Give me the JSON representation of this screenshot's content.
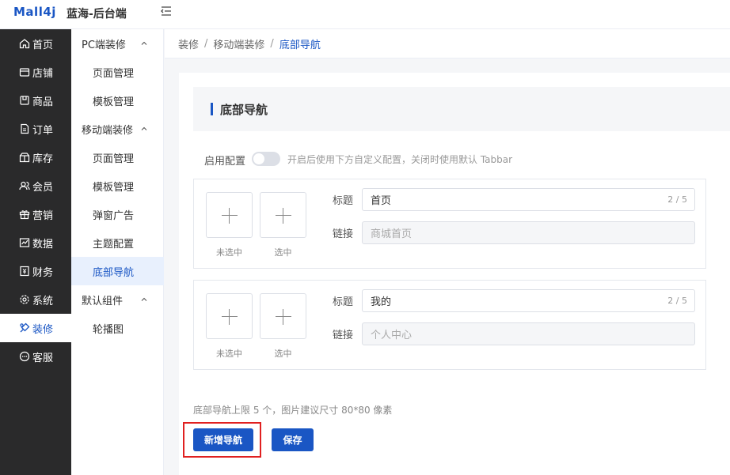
{
  "app": {
    "logo": "Mall4j",
    "name": "蓝海-后台端"
  },
  "sidebar": {
    "items": [
      {
        "label": "首页",
        "icon": "home-icon"
      },
      {
        "label": "店铺",
        "icon": "store-icon"
      },
      {
        "label": "商品",
        "icon": "goods-icon"
      },
      {
        "label": "订单",
        "icon": "order-icon"
      },
      {
        "label": "库存",
        "icon": "inventory-icon"
      },
      {
        "label": "会员",
        "icon": "member-icon"
      },
      {
        "label": "营销",
        "icon": "gift-icon"
      },
      {
        "label": "数据",
        "icon": "chart-icon"
      },
      {
        "label": "财务",
        "icon": "finance-icon"
      },
      {
        "label": "系统",
        "icon": "gear-icon"
      },
      {
        "label": "装修",
        "icon": "decorate-icon",
        "active": true
      },
      {
        "label": "客服",
        "icon": "chat-icon"
      }
    ]
  },
  "submenu": {
    "groups": [
      {
        "label": "PC端装修",
        "items": [
          "页面管理",
          "模板管理"
        ]
      },
      {
        "label": "移动端装修",
        "items": [
          "页面管理",
          "模板管理",
          "弹窗广告",
          "主题配置",
          "底部导航"
        ]
      },
      {
        "label": "默认组件",
        "items": [
          "轮播图"
        ]
      }
    ],
    "active": "底部导航"
  },
  "breadcrumb": [
    "装修",
    "移动端装修",
    "底部导航"
  ],
  "panel": {
    "title": "底部导航",
    "config_label": "启用配置",
    "config_enabled": false,
    "config_hint": "开启后使用下方自定义配置，关闭时使用默认 Tabbar",
    "nav_items": [
      {
        "unselected_caption": "未选中",
        "selected_caption": "选中",
        "title_label": "标题",
        "title_value": "首页",
        "title_count": "2 / 5",
        "link_label": "链接",
        "link_placeholder": "商城首页"
      },
      {
        "unselected_caption": "未选中",
        "selected_caption": "选中",
        "title_label": "标题",
        "title_value": "我的",
        "title_count": "2 / 5",
        "link_label": "链接",
        "link_placeholder": "个人中心"
      }
    ],
    "note": "底部导航上限 5 个，图片建议尺寸 80*80 像素",
    "add_button": "新增导航",
    "save_button": "保存"
  },
  "colors": {
    "accent": "#1a56c4",
    "sidebar_bg": "#2a2a2b",
    "highlight": "#e02020"
  }
}
